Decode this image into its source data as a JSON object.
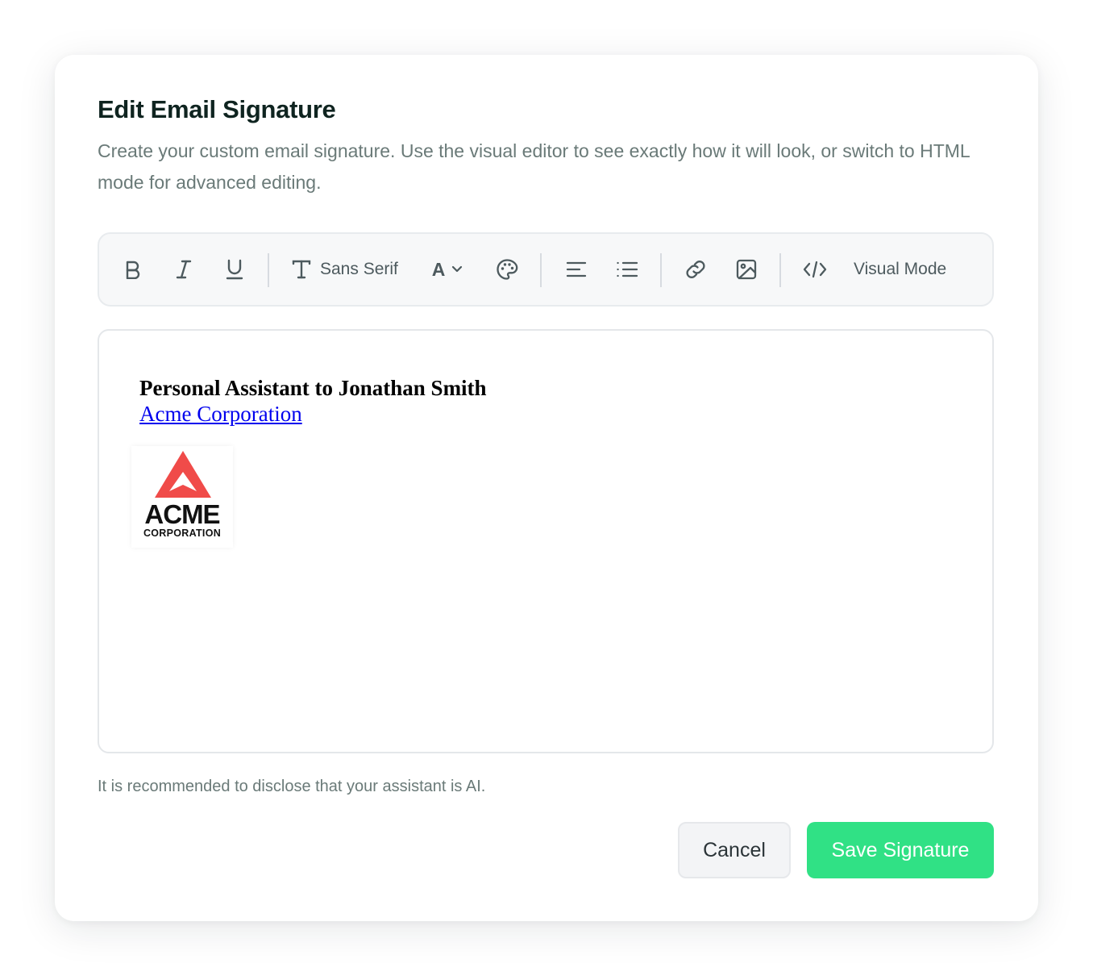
{
  "dialog": {
    "title": "Edit Email Signature",
    "description": "Create your custom email signature. Use the visual editor to see exactly how it will look, or switch to HTML mode for advanced editing."
  },
  "toolbar": {
    "icons": [
      "bold-icon",
      "italic-icon",
      "underline-icon",
      "text-type-icon",
      "font-size-icon",
      "chevron-down-icon",
      "palette-icon",
      "align-left-icon",
      "list-icon",
      "link-icon",
      "image-icon",
      "code-icon"
    ],
    "font_family": "Sans Serif",
    "font_size_glyph": "A",
    "mode_label": "Visual Mode"
  },
  "signature": {
    "title_line": "Personal Assistant to Jonathan Smith",
    "company_link": "Acme Corporation",
    "logo": {
      "word": "ACME",
      "subword": "CORPORATION",
      "mark_color": "#f04b49"
    }
  },
  "note": "It is recommended to disclose that your assistant is AI.",
  "actions": {
    "cancel_label": "Cancel",
    "save_label": "Save Signature"
  },
  "colors": {
    "accent": "#30e185",
    "link": "#0000ee",
    "title": "#0f2420",
    "muted_text": "#6a7a78"
  }
}
